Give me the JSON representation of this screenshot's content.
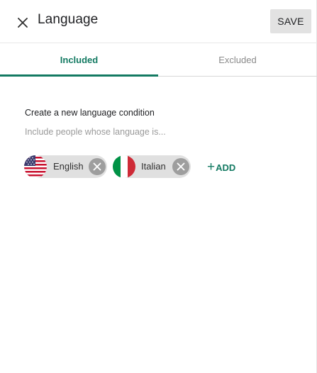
{
  "header": {
    "title": "Language",
    "save_label": "SAVE"
  },
  "tabs": [
    {
      "label": "Included",
      "active": true
    },
    {
      "label": "Excluded",
      "active": false
    }
  ],
  "condition": {
    "title": "Create a new language condition",
    "hint": "Include people whose language is..."
  },
  "chips": [
    {
      "label": "English",
      "flag": "us-flag-icon"
    },
    {
      "label": "Italian",
      "flag": "italy-flag-icon"
    }
  ],
  "add_label": "ADD",
  "add_icon": "+",
  "colors": {
    "accent": "#137a62",
    "chip_bg": "#e0e0e0",
    "save_bg": "#e2e2e2"
  }
}
